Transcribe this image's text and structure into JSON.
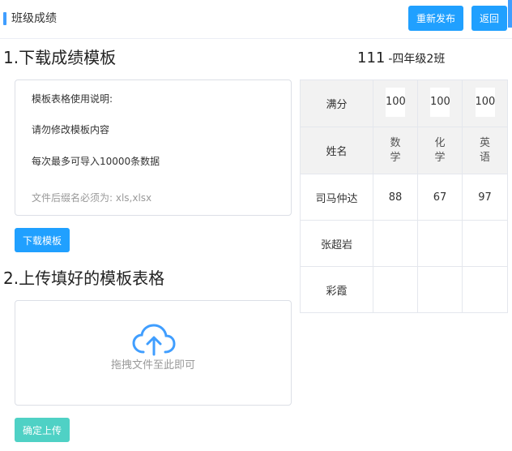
{
  "header": {
    "title": "班级成绩",
    "republish_label": "重新发布",
    "back_label": "返回"
  },
  "section1": {
    "title": "1.下载成绩模板",
    "instructions": [
      "模板表格使用说明:",
      "请勿修改模板内容",
      "每次最多可导入10000条数据"
    ],
    "file_note": "文件后缀名必须为: xls,xlsx",
    "download_label": "下载模板"
  },
  "section2": {
    "title": "2.上传填好的模板表格",
    "upload_text": "拖拽文件至此即可",
    "confirm_label": "确定上传"
  },
  "class_info": {
    "number": "111",
    "name": "-四年级2班"
  },
  "table": {
    "full_score_label": "满分",
    "name_label": "姓名",
    "full_scores": [
      "100",
      "100",
      "100"
    ],
    "subjects": [
      "数学",
      "化学",
      "英语"
    ],
    "students": [
      {
        "name": "司马仲达",
        "scores": [
          "88",
          "67",
          "97"
        ]
      },
      {
        "name": "张超岩",
        "scores": [
          "",
          "",
          ""
        ]
      },
      {
        "name": "彩霞",
        "scores": [
          "",
          "",
          ""
        ]
      }
    ]
  },
  "colors": {
    "accent": "#409eff",
    "button": "#20a0ff",
    "confirm": "#4fd1c5",
    "cloud_icon": "#409eff"
  },
  "icons": {
    "upload": "cloud-upload-icon"
  }
}
